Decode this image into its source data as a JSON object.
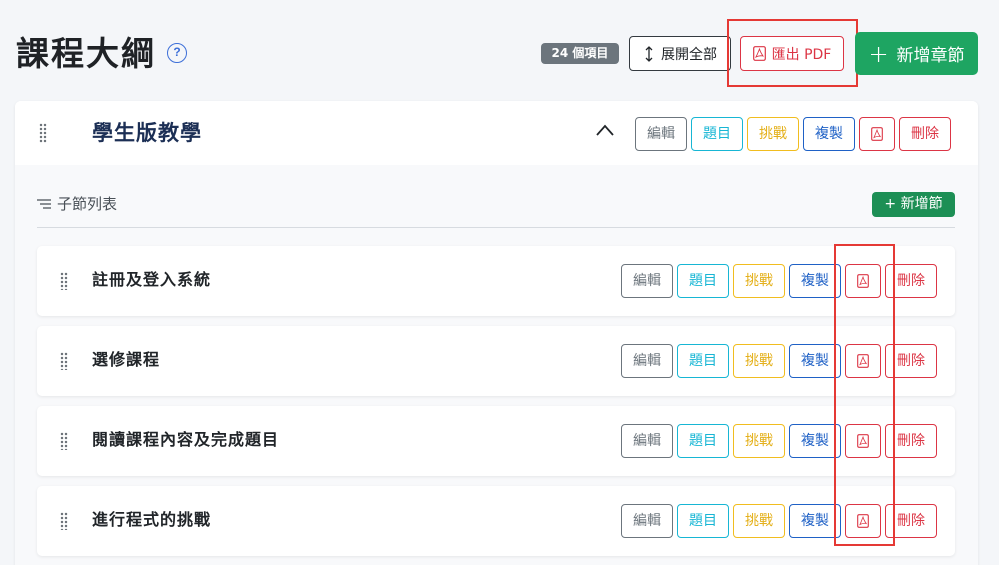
{
  "header": {
    "title": "課程大綱",
    "help_icon": "question-circle-icon",
    "count_badge": "24 個項目",
    "expand_label": "展開全部",
    "export_label": "匯出 PDF",
    "add_chapter_label": "新增章節",
    "add_chapter_plus": "+"
  },
  "chapter": {
    "title": "學生版教學",
    "actions": {
      "edit": "編輯",
      "quiz": "題目",
      "challenge": "挑戰",
      "copy": "複製",
      "delete": "刪除"
    },
    "sub_list_label": "子節列表",
    "add_section_label": "+ 新增節",
    "sections": [
      {
        "title": "註冊及登入系統"
      },
      {
        "title": "選修課程"
      },
      {
        "title": "閱讀課程內容及完成題目"
      },
      {
        "title": "進行程式的挑戰"
      }
    ]
  },
  "colors": {
    "primary_green": "#1ea562",
    "danger": "#dc3545",
    "info": "#17b6d4",
    "warning": "#f1bd1f",
    "primary_blue": "#1f61c6",
    "highlight": "#e53935"
  }
}
